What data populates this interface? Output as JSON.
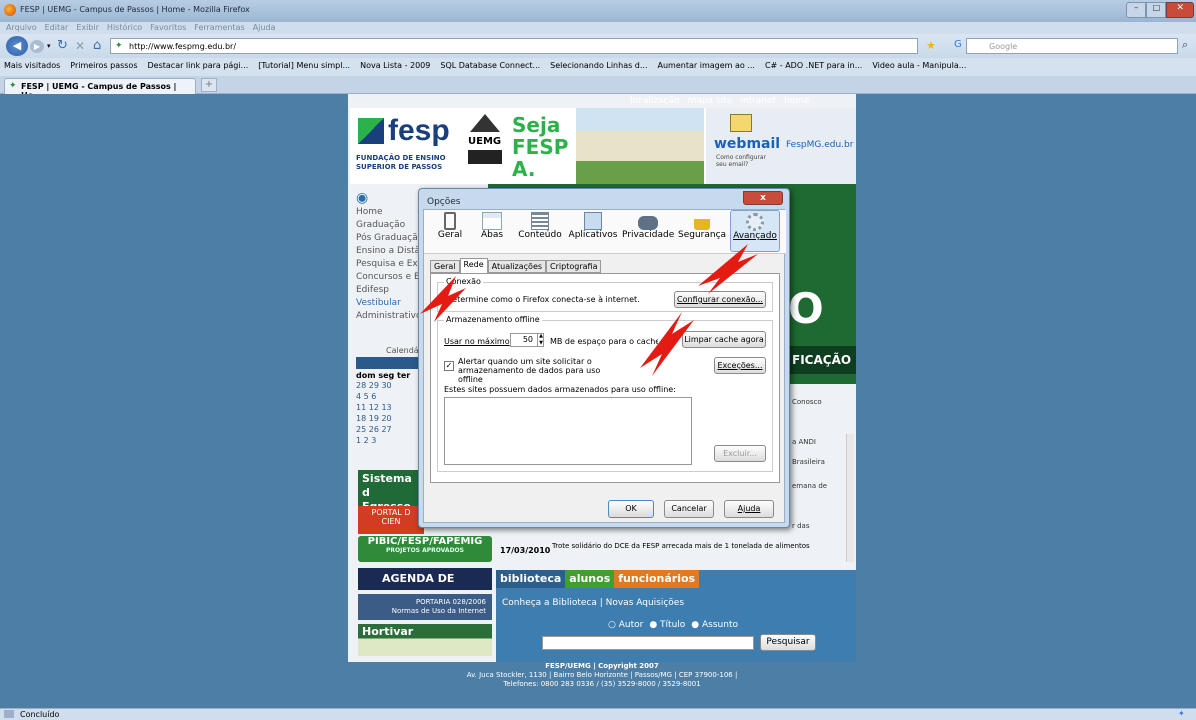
{
  "window": {
    "title": "FESP | UEMG - Campus de Passos | Home - Mozilla Firefox"
  },
  "menu": [
    "Arquivo",
    "Editar",
    "Exibir",
    "Histórico",
    "Favoritos",
    "Ferramentas",
    "Ajuda"
  ],
  "nav": {
    "url": "http://www.fespmg.edu.br/",
    "search_placeholder": "Google"
  },
  "bookmarks": [
    "Mais visitados",
    "Primeiros passos",
    "Destacar link para pági...",
    "[Tutorial] Menu simpl...",
    "Nova Lista - 2009",
    "SQL Database Connect...",
    "Selecionando Linhas d...",
    "Aumentar imagem ao ...",
    "C# - ADO .NET para in...",
    "Video aula - Manipula..."
  ],
  "tab": {
    "label": "FESP | UEMG - Campus de Passos | Ho...",
    "new_tab": "+"
  },
  "site": {
    "toplinks": [
      "localização",
      "mapa site",
      "intranet",
      "home"
    ],
    "logo": "fesp",
    "logo_sub": "FUNDAÇÃO DE ENSINO SUPERIOR DE PASSOS",
    "uemg": "UEMG",
    "seja": "Seja FESP A.",
    "webmail": "webmail",
    "webmail_sub": "Como configurar seu email?",
    "domain": "FespMG.edu.br",
    "left_menu": [
      "Home",
      "Graduação",
      "Pós Graduação",
      "Ensino a Distân",
      "Pesquisa e Ext",
      "Concursos e E",
      "Edifesp",
      "Vestibular",
      "Administrativo"
    ],
    "calendar_label": "Calendár",
    "weekdays": "dom seg ter",
    "cal_rows": [
      "28 29 30",
      "4 5 6",
      "11 12 13",
      "18 19 20",
      "25 26 27",
      "1 2 3"
    ],
    "banners": [
      "Sistema d",
      "Egresso",
      "PORTAL D",
      "CIEN",
      "PIBIC/FESP/FAPEMIG",
      "PROJETOS APROVADOS",
      "AGENDA DE EVENTOS",
      "PORTARIA 028/2006",
      "Normas de Uso da Internet",
      "Hortivar"
    ],
    "news": [
      {
        "date": "",
        "text": "Conosco"
      },
      {
        "date": "",
        "text": "a ANDI"
      },
      {
        "date": "",
        "text": "Brasileira"
      },
      {
        "date": "",
        "text": "emana de"
      },
      {
        "date": "",
        "text": "r das"
      },
      {
        "date": "17/03/2010",
        "text": "Trote solidário do DCE da FESP arrecada mais de 1 tonelada de alimentos"
      }
    ],
    "big_letter": "O",
    "ficacao": "FICAÇÃO",
    "bib_tabs": [
      "biblioteca",
      "alunos",
      "funcionários"
    ],
    "bib_links": "Conheça a Biblioteca | Novas Aquisições",
    "radios": [
      "Autor",
      "Título",
      "Assunto"
    ],
    "search_btn": "Pesquisar",
    "footer1": "FESP/UEMG | Copyright 2007",
    "footer2": "Av. Juca Stockler, 1130 | Bairro Belo Horizonte | Passos/MG | CEP 37900-106 |",
    "footer3": "Telefones: 0800 283 0336 / (35) 3529-8000 / 3529-8001"
  },
  "dialog": {
    "title": "Opções",
    "close": "x",
    "categories": [
      "Geral",
      "Abas",
      "Conteúdo",
      "Aplicativos",
      "Privacidade",
      "Segurança",
      "Avançado"
    ],
    "subtabs": [
      "Geral",
      "Rede",
      "Atualizações",
      "Criptografia"
    ],
    "conexao_group": "Conexão",
    "conexao_text": "Determine como o Firefox conecta-se à internet.",
    "conexao_btn": "Configurar conexão...",
    "offline_group": "Armazenamento offline",
    "usar_label": "Usar no máximo",
    "usar_value": "50",
    "mb_label": "MB de espaço para o cache",
    "limpar_btn": "Limpar cache agora",
    "alert_text": "Alertar quando um site solicitar o armazenamento de dados para uso offline",
    "excecoes_btn": "Exceções...",
    "sites_text": "Estes sites possuem dados armazenados para uso offline:",
    "excluir_btn": "Excluir...",
    "ok": "OK",
    "cancel": "Cancelar",
    "help": "Ajuda"
  },
  "status": {
    "text": "Concluído"
  }
}
